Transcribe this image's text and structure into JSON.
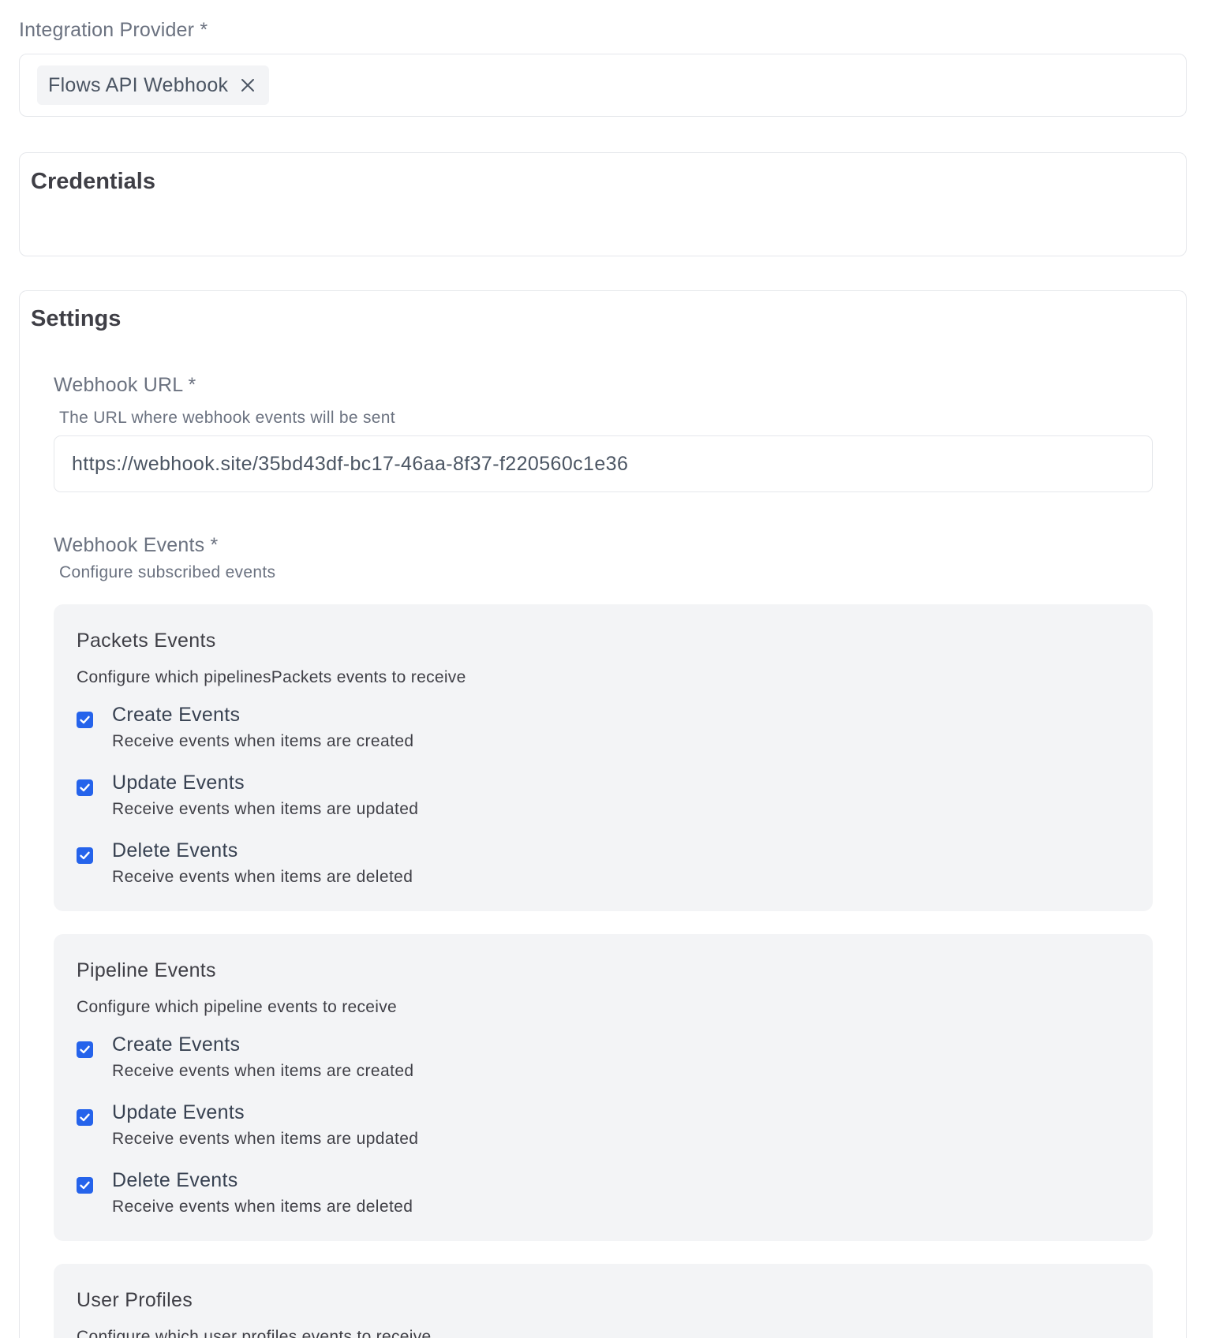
{
  "provider": {
    "label": "Integration Provider *",
    "selected": "Flows API Webhook"
  },
  "credentials": {
    "title": "Credentials"
  },
  "settings": {
    "title": "Settings",
    "webhook_url": {
      "label": "Webhook URL *",
      "help": "The URL where webhook events will be sent",
      "value": "https://webhook.site/35bd43df-bc17-46aa-8f37-f220560c1e36"
    },
    "webhook_events": {
      "label": "Webhook Events *",
      "help": "Configure subscribed events"
    },
    "groups": [
      {
        "title": "Packets Events",
        "description": "Configure which pipelinesPackets events to receive",
        "options": [
          {
            "label": "Create Events",
            "description": "Receive events when items are created",
            "checked": true
          },
          {
            "label": "Update Events",
            "description": "Receive events when items are updated",
            "checked": true
          },
          {
            "label": "Delete Events",
            "description": "Receive events when items are deleted",
            "checked": true
          }
        ]
      },
      {
        "title": "Pipeline Events",
        "description": "Configure which pipeline events to receive",
        "options": [
          {
            "label": "Create Events",
            "description": "Receive events when items are created",
            "checked": true
          },
          {
            "label": "Update Events",
            "description": "Receive events when items are updated",
            "checked": true
          },
          {
            "label": "Delete Events",
            "description": "Receive events when items are deleted",
            "checked": true
          }
        ]
      },
      {
        "title": "User Profiles",
        "description": "Configure which user profiles events to receive"
      }
    ]
  },
  "colors": {
    "checkbox": "#2563eb",
    "group_background": "#f3f4f6",
    "border": "#e5e7eb"
  }
}
